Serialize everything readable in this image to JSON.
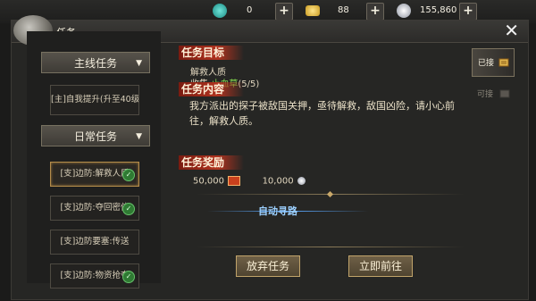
{
  "currency": [
    {
      "icon": "jade-icon",
      "value": "0"
    },
    {
      "icon": "gold-ingot-icon",
      "value": "88"
    },
    {
      "icon": "silver-coin-icon",
      "value": "155,860"
    }
  ],
  "window": {
    "title": "任务"
  },
  "categories": [
    {
      "label": "主线任务"
    },
    {
      "label": "日常任务"
    }
  ],
  "main_quests": [
    "[主]自我提升(升至40级)"
  ],
  "daily_quests": [
    {
      "label": "[支]边防:解救人质",
      "done": true,
      "selected": true
    },
    {
      "label": "[支]边防:夺回密信",
      "done": true
    },
    {
      "label": "[支]边防要塞:传送",
      "done": false
    },
    {
      "label": "[支]边防:物资抢夺",
      "done": true
    }
  ],
  "detail": {
    "goal_header": "任务目标",
    "goal_lines": [
      "解救人质"
    ],
    "collect_prefix": "收集:",
    "collect_item": "止血草",
    "collect_count": "(5/5)",
    "content_header": "任务内容",
    "content_text": "我方派出的探子被敌国关押，亟待解救，敌国凶险，请小心前往，解救人质。",
    "reward_header": "任务奖励",
    "reward_exp": "50,000",
    "reward_silver": "10,000",
    "autopath_label": "自动寻路"
  },
  "buttons": {
    "abandon": "放弃任务",
    "goto": "立即前往"
  },
  "side_tabs": [
    {
      "label": "已接",
      "active": true
    },
    {
      "label": "可接",
      "active": false
    }
  ],
  "colors": {
    "accent_red": "#b0331f",
    "gold_border": "#c0a36a",
    "green": "#7fd24d",
    "path_blue": "#5aa8ff"
  }
}
